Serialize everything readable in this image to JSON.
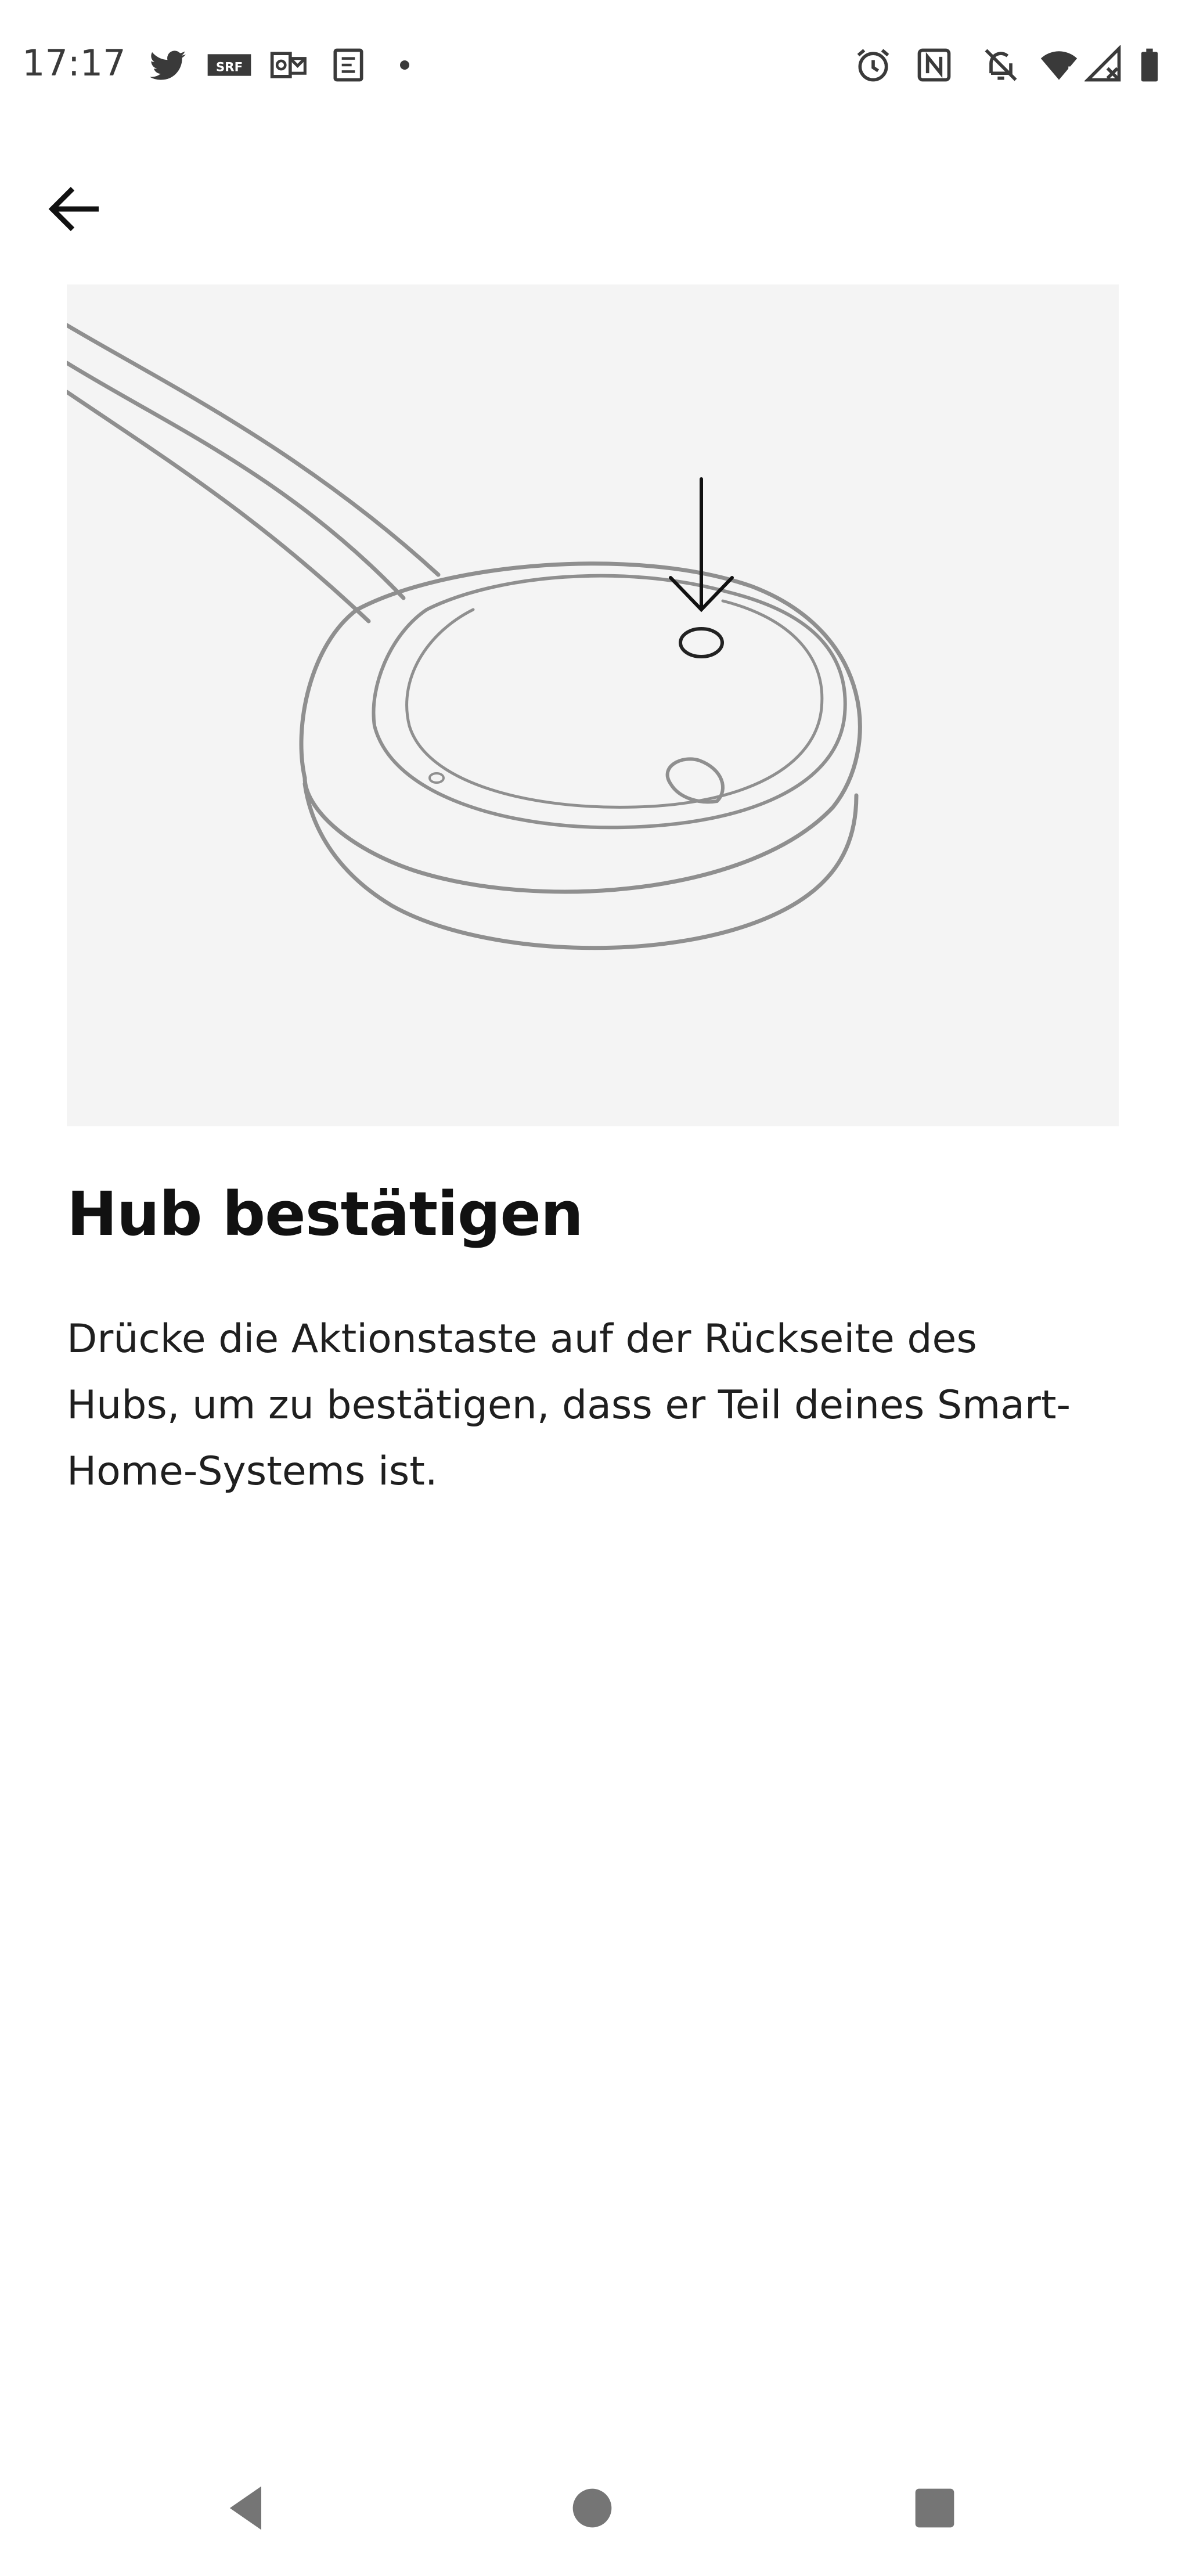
{
  "status_bar": {
    "time": "17:17",
    "notification_icons": [
      "twitter-icon",
      "srf-icon",
      "outlook-icon",
      "calendar-icon",
      "more-dot-icon"
    ],
    "system_icons": [
      "alarm-icon",
      "nfc-icon",
      "mute-bell-icon",
      "wifi-icon",
      "signal-icon",
      "battery-icon"
    ],
    "srf_label": "SRF"
  },
  "header": {
    "back_icon": "arrow-left-icon"
  },
  "illustration": {
    "subject": "hub-with-action-button"
  },
  "content": {
    "title": "Hub bestätigen",
    "body": "Drücke die Aktionstaste auf der Rückseite des Hubs, um zu bestätigen, dass er Teil deines Smart-Home-Systems ist."
  },
  "nav_bar": {
    "buttons": [
      "back-triangle-icon",
      "home-circle-icon",
      "recents-square-icon"
    ]
  },
  "colors": {
    "background": "#ffffff",
    "illustration_bg": "#f4f4f4",
    "text": "#111111",
    "nav_icon": "#757575"
  }
}
